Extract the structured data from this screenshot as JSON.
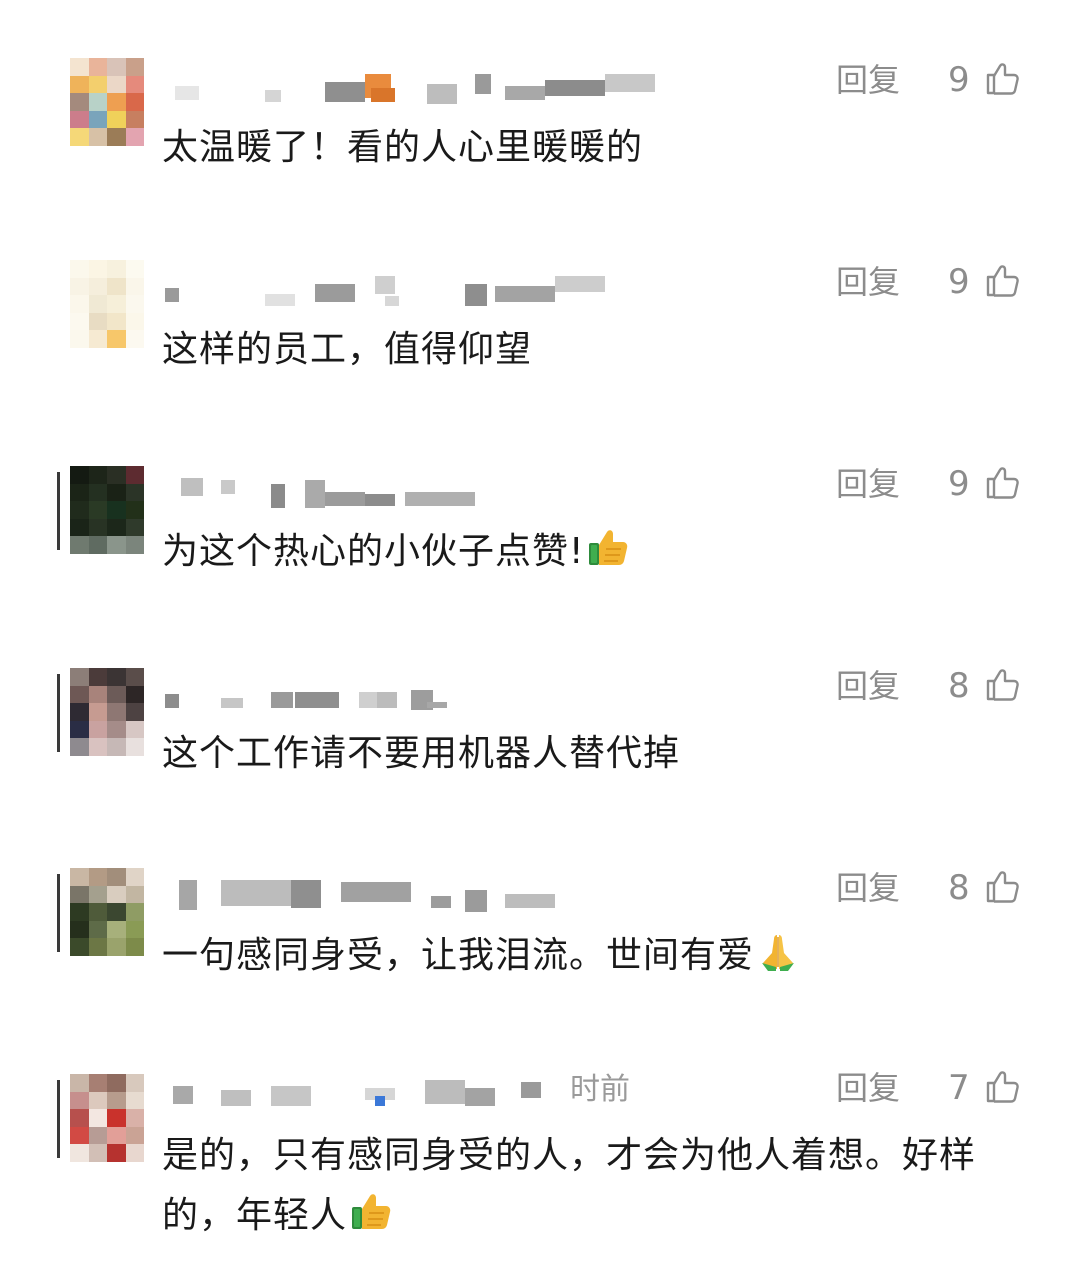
{
  "comments": [
    {
      "reply_label": "回复",
      "likes": "9",
      "text": "太温暖了！看的人心里暖暖的",
      "time_text": "",
      "emoji": "",
      "avatar_colors": [
        "#f4e4d0",
        "#e9b49a",
        "#d9c3b8",
        "#c9a08a",
        "#efb35a",
        "#f3cf6d",
        "#ebd7c7",
        "#e58a7c",
        "#a48a7d",
        "#b8d2c8",
        "#ee9f51",
        "#d9684a",
        "#cc7d8b",
        "#7aa4bb",
        "#f0d15a",
        "#c77f60",
        "#f5d878",
        "#d7c1a6",
        "#9b7c57",
        "#e3a4b0"
      ]
    },
    {
      "reply_label": "回复",
      "likes": "9",
      "text": "这样的员工，值得仰望",
      "time_text": "",
      "emoji": "",
      "avatar_colors": [
        "#fbf8ec",
        "#fbf5e4",
        "#f7f1de",
        "#fcfaf0",
        "#f8f3e5",
        "#f5eedc",
        "#efe4c9",
        "#faf6ea",
        "#fbf7eb",
        "#f0e9d4",
        "#f6efd9",
        "#fbf8ee",
        "#fcf9ef",
        "#e8dcc3",
        "#f2e6c9",
        "#fbf7ea",
        "#fbf8ed",
        "#f6ead2",
        "#f7c76a",
        "#fcf9f0"
      ]
    },
    {
      "reply_label": "回复",
      "likes": "9",
      "text": "为这个热心的小伙子点赞!",
      "time_text": "",
      "emoji": "thumbs-up",
      "avatar_colors": [
        "#141a12",
        "#1d2519",
        "#2a2f24",
        "#5d2b30",
        "#1b2417",
        "#243021",
        "#1a2216",
        "#2b3427",
        "#202b1c",
        "#2a3a25",
        "#18311f",
        "#223019",
        "#1a2418",
        "#283324",
        "#1c271a",
        "#2f3a2b",
        "#6f7a6f",
        "#5f6b61",
        "#8a958b",
        "#7b857c"
      ]
    },
    {
      "reply_label": "回复",
      "likes": "8",
      "text": "这个工作请不要用机器人替代掉",
      "time_text": "",
      "emoji": "",
      "avatar_colors": [
        "#8c7e78",
        "#4b3b3a",
        "#3b3434",
        "#5a4d4a",
        "#6e5855",
        "#a8837b",
        "#6c5b58",
        "#2d2626",
        "#2e2a33",
        "#c69b91",
        "#8e7773",
        "#4d4242",
        "#2a2d45",
        "#c9a2a0",
        "#a58c89",
        "#d7c7c4",
        "#8e8a8f",
        "#d9c2c0",
        "#c6b8b6",
        "#e8e0de"
      ]
    },
    {
      "reply_label": "回复",
      "likes": "8",
      "text": "一句感同身受，让我泪流。世间有爱",
      "time_text": "",
      "emoji": "folded-hands",
      "avatar_colors": [
        "#c9b7a4",
        "#b39b85",
        "#a28e7b",
        "#e0d4c7",
        "#7a7568",
        "#a4a08e",
        "#d9cdbf",
        "#c2b6a2",
        "#2d3a22",
        "#4f5b3a",
        "#3b4730",
        "#8f9c64",
        "#252f1c",
        "#5e6b48",
        "#a7b07b",
        "#8a9b55",
        "#3b4a2a",
        "#6c7745",
        "#9aa36c",
        "#7d8b4a"
      ]
    },
    {
      "reply_label": "回复",
      "likes": "7",
      "text": "是的，只有感同身受的人，才会为他人着想。好样的，年轻人",
      "time_text": "时前",
      "emoji": "thumbs-up",
      "avatar_colors": [
        "#c9b6a8",
        "#a77f73",
        "#8f6b5f",
        "#d8c9bd",
        "#c68f8d",
        "#dcc9bd",
        "#b79c8d",
        "#e7dbd0",
        "#b7504d",
        "#f3e7e1",
        "#c9322c",
        "#d9b1a8",
        "#d24a44",
        "#b79c95",
        "#e29f98",
        "#caa395",
        "#f0e6df",
        "#d2bfb6",
        "#b6322f",
        "#e8d7cf"
      ]
    }
  ]
}
